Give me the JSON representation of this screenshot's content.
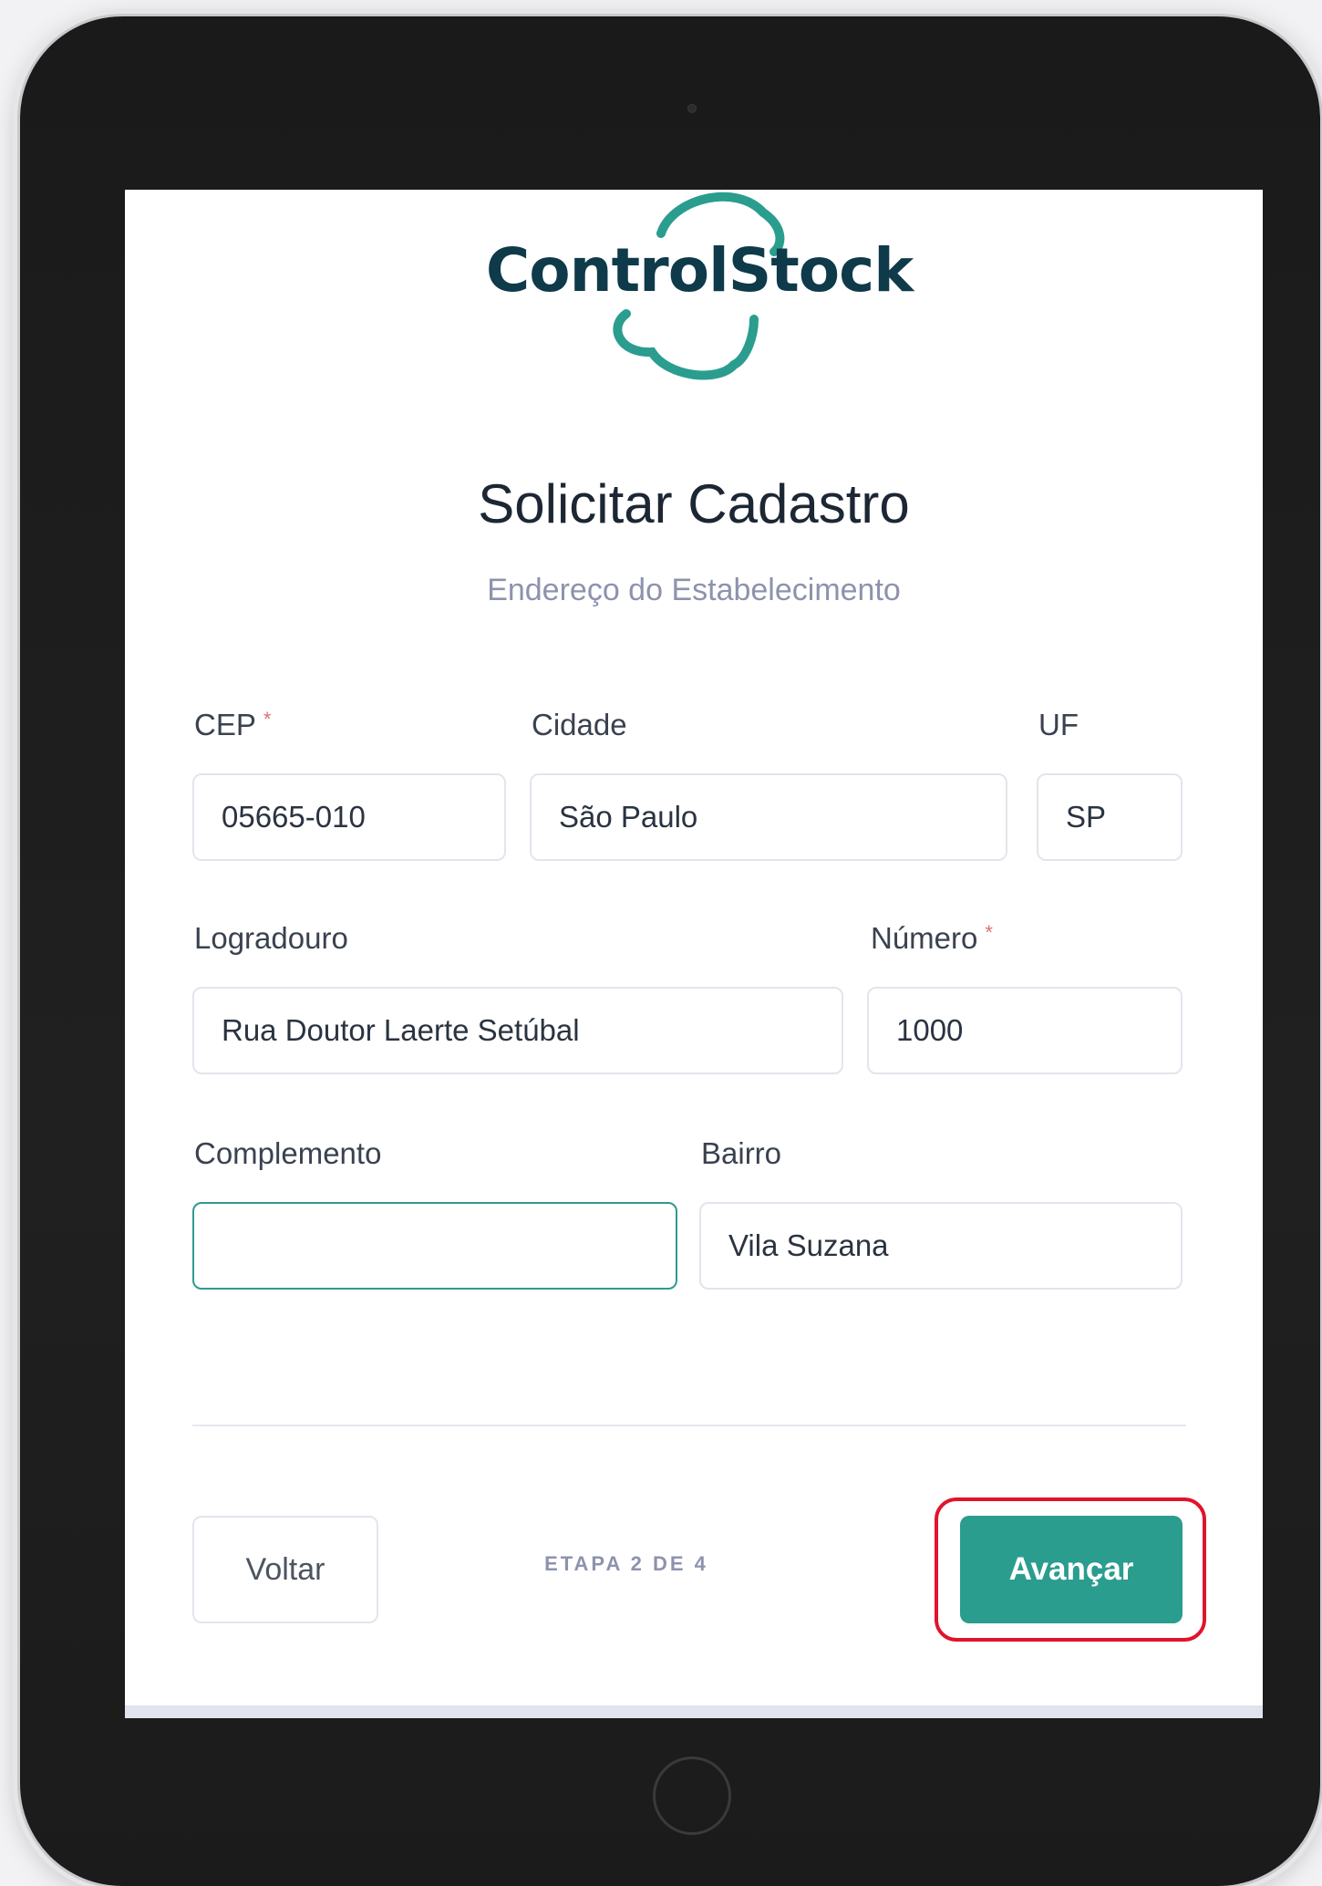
{
  "app": {
    "logo_text": "ControlStock",
    "brand_color": "#2a9d8f",
    "text_dark": "#0f3a4a"
  },
  "page": {
    "title": "Solicitar Cadastro",
    "subtitle": "Endereço do Estabelecimento"
  },
  "form": {
    "cep": {
      "label": "CEP",
      "required_mark": "*",
      "value": "05665-010"
    },
    "cidade": {
      "label": "Cidade",
      "value": "São Paulo"
    },
    "uf": {
      "label": "UF",
      "value": "SP"
    },
    "logradouro": {
      "label": "Logradouro",
      "value": "Rua Doutor Laerte Setúbal"
    },
    "numero": {
      "label": "Número",
      "required_mark": "*",
      "value": "1000"
    },
    "complemento": {
      "label": "Complemento",
      "value": ""
    },
    "bairro": {
      "label": "Bairro",
      "value": "Vila Suzana"
    }
  },
  "footer": {
    "back_label": "Voltar",
    "step_text": "ETAPA 2 DE 4",
    "next_label": "Avançar",
    "highlight_color": "#e0142c"
  },
  "icons": {
    "logo": "cloud-outline-icon"
  }
}
